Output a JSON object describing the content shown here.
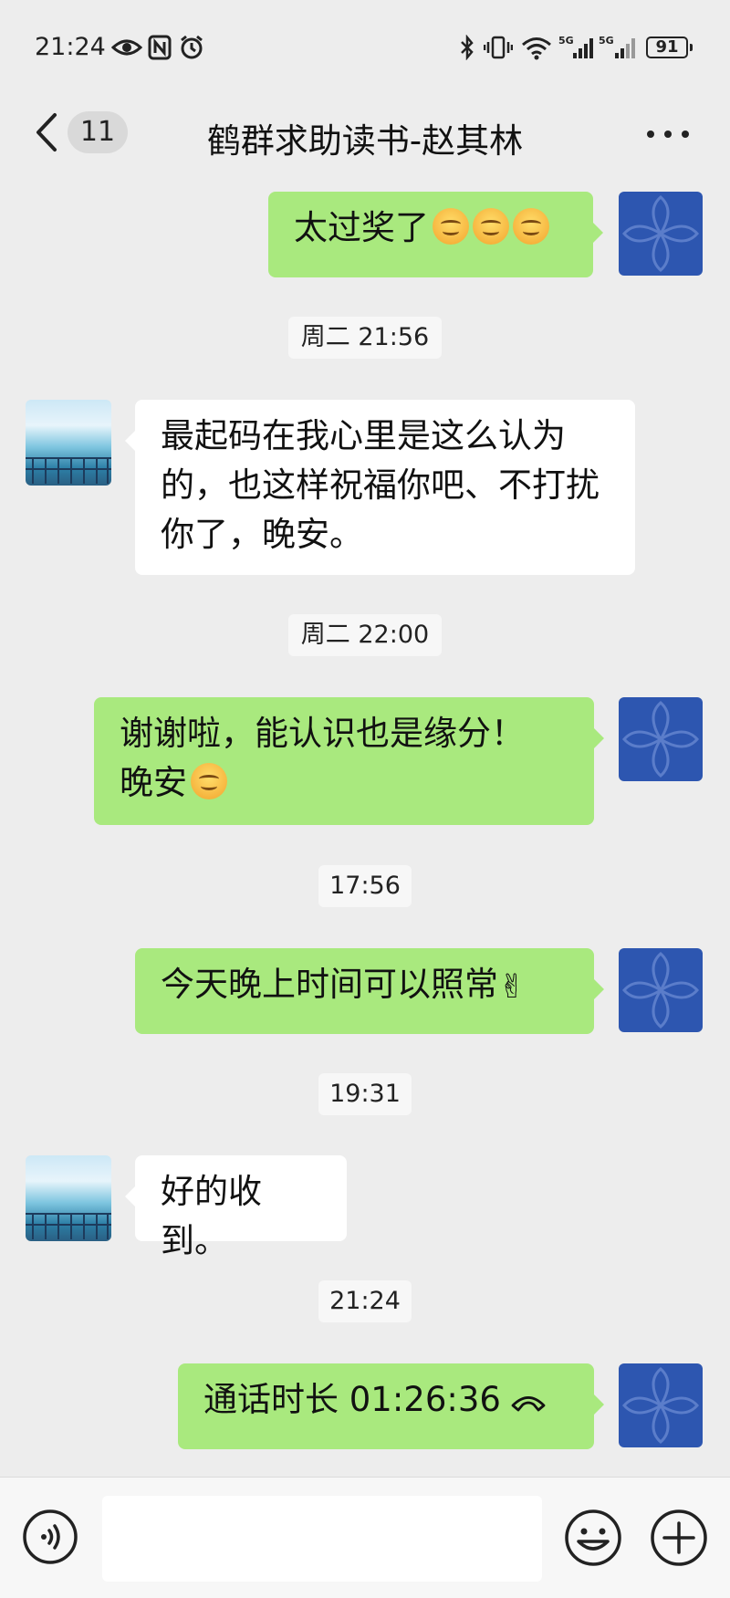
{
  "status_bar": {
    "time": "21:24",
    "battery": "91",
    "network_1": "5G",
    "network_2": "5G",
    "wifi_level": "6"
  },
  "header": {
    "unread_count": "11",
    "title": "鹤群求助读书-赵其林"
  },
  "messages": [
    {
      "text": "太过奖了"
    },
    {
      "time": "周二 21:56"
    },
    {
      "text": "最起码在我心里是这么认为的，也这样祝福你吧、不打扰你了，晚安。"
    },
    {
      "time": "周二 22:00"
    },
    {
      "text_line1": "谢谢啦，能认识也是缘分！",
      "text_line2": "晚安"
    },
    {
      "time": "17:56"
    },
    {
      "text": "今天晚上时间可以照常",
      "emoji": "✌"
    },
    {
      "time": "19:31"
    },
    {
      "text": "好的收到。"
    },
    {
      "time": "21:24"
    },
    {
      "text": "通话时长 01:26:36"
    }
  ],
  "colors": {
    "bubble_me": "#a9e97e",
    "bubble_other": "#ffffff",
    "background": "#ededed",
    "avatar_me": "#2d56b0"
  }
}
